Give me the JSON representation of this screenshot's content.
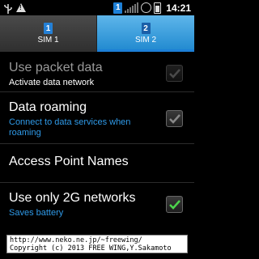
{
  "statusbar": {
    "time": "14:21",
    "sim_indicator": "1",
    "icons": [
      "usb-icon",
      "warning-icon",
      "sim-indicator",
      "signal-icon",
      "sync-icon",
      "battery-icon"
    ]
  },
  "tabs": [
    {
      "label": "SIM 1",
      "sim_number": "1",
      "active": false
    },
    {
      "label": "SIM 2",
      "sim_number": "2",
      "active": true
    }
  ],
  "settings": {
    "packet_data": {
      "title": "Use packet data",
      "summary": "Activate data network",
      "checked": true,
      "enabled": false
    },
    "data_roaming": {
      "title": "Data roaming",
      "summary": "Connect to data services when roaming",
      "checked": true,
      "enabled": true
    },
    "apn": {
      "title": "Access Point Names"
    },
    "only_2g": {
      "title": "Use only 2G networks",
      "summary": "Saves battery",
      "checked": true,
      "enabled": true
    }
  },
  "banner": {
    "line1": "http://www.neko.ne.jp/~freewing/",
    "line2": "Copyright (c) 2013 FREE WING,Y.Sakamoto"
  },
  "colors": {
    "accent": "#1d7fd6",
    "summary_blue": "#2f9ae8",
    "check_green": "#4cd44c",
    "check_grey": "#888888"
  }
}
